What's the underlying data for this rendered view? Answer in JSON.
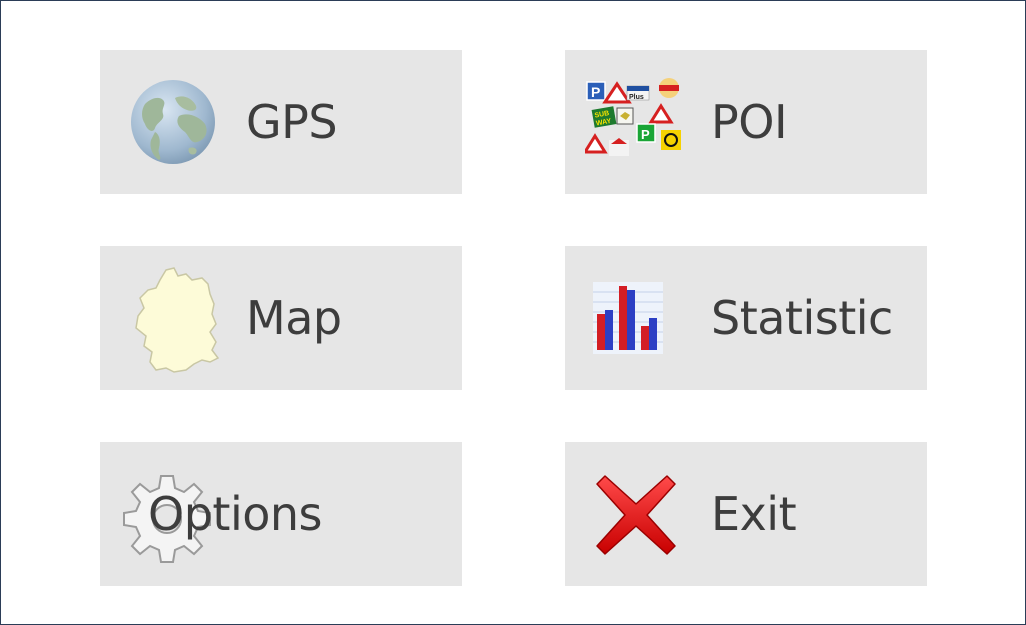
{
  "window": {
    "title": "",
    "colors": {
      "frame_border": "#2b3d57",
      "tile_bg": "#e6e6e6",
      "text": "#3d3d3d"
    }
  },
  "menu": {
    "gps": {
      "label": "GPS",
      "icon": "globe-icon"
    },
    "poi": {
      "label": "POI",
      "icon": "poi-signs-icon"
    },
    "map": {
      "label": "Map",
      "icon": "germany-map-icon"
    },
    "statistic": {
      "label": "Statistic",
      "icon": "bar-chart-icon"
    },
    "options": {
      "label": "Options",
      "icon": "gear-icon"
    },
    "exit": {
      "label": "Exit",
      "icon": "red-x-icon"
    }
  }
}
